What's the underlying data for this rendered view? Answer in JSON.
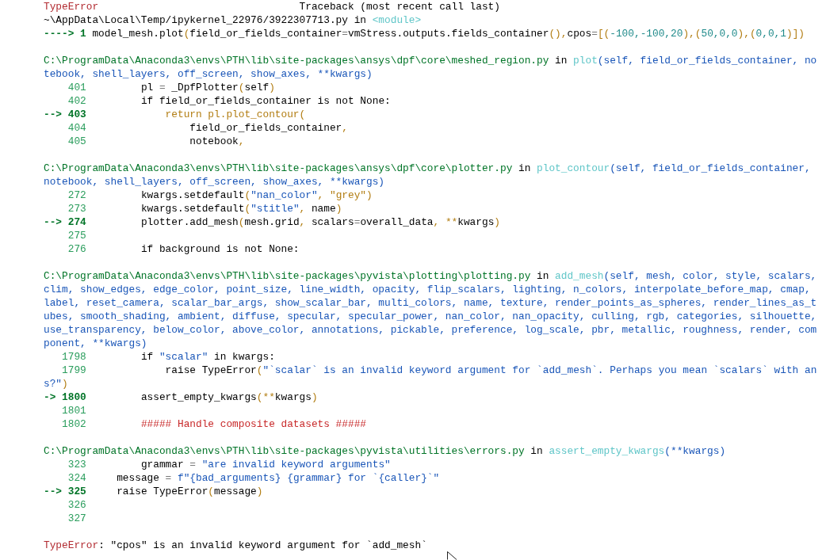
{
  "blocks": [
    {
      "lines": [
        {
          "parts": [
            {
              "kind": "ename",
              "text": "TypeError"
            },
            {
              "kind": "plain",
              "text": "                                 Traceback (most recent call last)"
            }
          ]
        },
        {
          "parts": [
            {
              "kind": "plain",
              "text": "~\\AppData\\Local\\Temp/ipykernel_22976/3922307713.py in "
            },
            {
              "kind": "fn",
              "text": "<module>"
            }
          ]
        },
        {
          "parts": [
            {
              "kind": "cur",
              "text": "----> 1 "
            },
            {
              "kind": "plain",
              "text": "model_mesh.plot"
            },
            {
              "kind": "punct",
              "text": "("
            },
            {
              "kind": "plain",
              "text": "field_or_fields_container"
            },
            {
              "kind": "op",
              "text": "="
            },
            {
              "kind": "plain",
              "text": "vmStress.outputs.fields_container"
            },
            {
              "kind": "punct",
              "text": "(),"
            },
            {
              "kind": "plain",
              "text": "cpos"
            },
            {
              "kind": "op",
              "text": "="
            },
            {
              "kind": "punct",
              "text": "[("
            },
            {
              "kind": "lit",
              "text": "-100,-100,20"
            },
            {
              "kind": "punct",
              "text": "),("
            },
            {
              "kind": "lit",
              "text": "50,0,0"
            },
            {
              "kind": "punct",
              "text": "),("
            },
            {
              "kind": "lit",
              "text": "0,0,1"
            },
            {
              "kind": "punct",
              "text": ")])"
            }
          ]
        }
      ]
    },
    {
      "lines": [
        {
          "parts": [
            {
              "kind": "path",
              "text": "C:\\ProgramData\\Anaconda3\\envs\\PTH\\lib\\site-packages\\ansys\\dpf\\core\\meshed_region.py"
            },
            {
              "kind": "plain",
              "text": " in "
            },
            {
              "kind": "fn",
              "text": "plot"
            },
            {
              "kind": "arg",
              "text": "(self, field_or_fields_container, no"
            }
          ]
        },
        {
          "parts": [
            {
              "kind": "arg",
              "text": "tebook, shell_layers, off_screen, show_axes, **kwargs)"
            }
          ]
        },
        {
          "parts": [
            {
              "kind": "num",
              "text": "    401"
            },
            {
              "kind": "plain",
              "text": "         pl "
            },
            {
              "kind": "op",
              "text": "="
            },
            {
              "kind": "plain",
              "text": " _DpfPlotter"
            },
            {
              "kind": "punct",
              "text": "("
            },
            {
              "kind": "plain",
              "text": "self"
            },
            {
              "kind": "punct",
              "text": ")"
            }
          ]
        },
        {
          "parts": [
            {
              "kind": "num",
              "text": "    402"
            },
            {
              "kind": "plain",
              "text": "         if field_or_fields_container is not None:"
            }
          ]
        },
        {
          "parts": [
            {
              "kind": "cur",
              "text": "--> 403"
            },
            {
              "kind": "punct",
              "text": "             return pl.plot_contour("
            }
          ]
        },
        {
          "parts": [
            {
              "kind": "num",
              "text": "    404"
            },
            {
              "kind": "plain",
              "text": "                 field_or_fields_container"
            },
            {
              "kind": "punct",
              "text": ","
            }
          ]
        },
        {
          "parts": [
            {
              "kind": "num",
              "text": "    405"
            },
            {
              "kind": "plain",
              "text": "                 notebook"
            },
            {
              "kind": "punct",
              "text": ","
            }
          ]
        }
      ]
    },
    {
      "lines": [
        {
          "parts": [
            {
              "kind": "path",
              "text": "C:\\ProgramData\\Anaconda3\\envs\\PTH\\lib\\site-packages\\ansys\\dpf\\core\\plotter.py"
            },
            {
              "kind": "plain",
              "text": " in "
            },
            {
              "kind": "fn",
              "text": "plot_contour"
            },
            {
              "kind": "arg",
              "text": "(self, field_or_fields_container,"
            }
          ]
        },
        {
          "parts": [
            {
              "kind": "arg",
              "text": "notebook, shell_layers, off_screen, show_axes, **kwargs)"
            }
          ]
        },
        {
          "parts": [
            {
              "kind": "num",
              "text": "    272"
            },
            {
              "kind": "plain",
              "text": "         kwargs.setdefault"
            },
            {
              "kind": "punct",
              "text": "("
            },
            {
              "kind": "str",
              "text": "\"nan_color\""
            },
            {
              "kind": "punct",
              "text": ", "
            },
            {
              "kind": "punct",
              "text": "\"grey\")"
            }
          ]
        },
        {
          "parts": [
            {
              "kind": "num",
              "text": "    273"
            },
            {
              "kind": "plain",
              "text": "         kwargs.setdefault"
            },
            {
              "kind": "punct",
              "text": "("
            },
            {
              "kind": "str",
              "text": "\"stitle\""
            },
            {
              "kind": "punct",
              "text": ", "
            },
            {
              "kind": "plain",
              "text": "name"
            },
            {
              "kind": "punct",
              "text": ")"
            }
          ]
        },
        {
          "parts": [
            {
              "kind": "cur",
              "text": "--> 274"
            },
            {
              "kind": "plain",
              "text": "         plotter.add_mesh"
            },
            {
              "kind": "punct",
              "text": "("
            },
            {
              "kind": "plain",
              "text": "mesh.grid"
            },
            {
              "kind": "punct",
              "text": ", "
            },
            {
              "kind": "plain",
              "text": "scalars"
            },
            {
              "kind": "op",
              "text": "="
            },
            {
              "kind": "plain",
              "text": "overall_data"
            },
            {
              "kind": "punct",
              "text": ", **"
            },
            {
              "kind": "plain",
              "text": "kwargs"
            },
            {
              "kind": "punct",
              "text": ")"
            }
          ]
        },
        {
          "parts": [
            {
              "kind": "num",
              "text": "    275"
            }
          ]
        },
        {
          "parts": [
            {
              "kind": "num",
              "text": "    276"
            },
            {
              "kind": "plain",
              "text": "         if background is not None:"
            }
          ]
        }
      ]
    },
    {
      "lines": [
        {
          "parts": [
            {
              "kind": "path",
              "text": "C:\\ProgramData\\Anaconda3\\envs\\PTH\\lib\\site-packages\\pyvista\\plotting\\plotting.py"
            },
            {
              "kind": "plain",
              "text": " in "
            },
            {
              "kind": "fn",
              "text": "add_mesh"
            },
            {
              "kind": "arg",
              "text": "(self, mesh, color, style, scalars,"
            }
          ]
        },
        {
          "parts": [
            {
              "kind": "arg",
              "text": "clim, show_edges, edge_color, point_size, line_width, opacity, flip_scalars, lighting, n_colors, interpolate_before_map, cmap,"
            }
          ]
        },
        {
          "parts": [
            {
              "kind": "arg",
              "text": "label, reset_camera, scalar_bar_args, show_scalar_bar, multi_colors, name, texture, render_points_as_spheres, render_lines_as_t"
            }
          ]
        },
        {
          "parts": [
            {
              "kind": "arg",
              "text": "ubes, smooth_shading, ambient, diffuse, specular, specular_power, nan_color, nan_opacity, culling, rgb, categories, silhouette,"
            }
          ]
        },
        {
          "parts": [
            {
              "kind": "arg",
              "text": "use_transparency, below_color, above_color, annotations, pickable, preference, log_scale, pbr, metallic, roughness, render, com"
            }
          ]
        },
        {
          "parts": [
            {
              "kind": "arg",
              "text": "ponent, **kwargs)"
            }
          ]
        },
        {
          "parts": [
            {
              "kind": "num",
              "text": "   1798"
            },
            {
              "kind": "plain",
              "text": "         if "
            },
            {
              "kind": "str",
              "text": "\"scalar\""
            },
            {
              "kind": "plain",
              "text": " in kwargs:"
            }
          ]
        },
        {
          "parts": [
            {
              "kind": "num",
              "text": "   1799"
            },
            {
              "kind": "plain",
              "text": "             raise TypeError"
            },
            {
              "kind": "punct",
              "text": "("
            },
            {
              "kind": "str",
              "text": "\"`scalar` is an invalid keyword argument for `add_mesh`. Perhaps you mean `scalars` with an"
            }
          ]
        },
        {
          "parts": [
            {
              "kind": "str",
              "text": "s?\""
            },
            {
              "kind": "punct",
              "text": ")"
            }
          ]
        },
        {
          "parts": [
            {
              "kind": "cur",
              "text": "-> 1800"
            },
            {
              "kind": "plain",
              "text": "         assert_empty_kwargs"
            },
            {
              "kind": "punct",
              "text": "(**"
            },
            {
              "kind": "plain",
              "text": "kwargs"
            },
            {
              "kind": "punct",
              "text": ")"
            }
          ]
        },
        {
          "parts": [
            {
              "kind": "num",
              "text": "   1801"
            }
          ]
        },
        {
          "parts": [
            {
              "kind": "num",
              "text": "   1802"
            },
            {
              "kind": "cmt",
              "text": "         ##### Handle composite datasets #####"
            }
          ]
        }
      ]
    },
    {
      "lines": [
        {
          "parts": [
            {
              "kind": "path",
              "text": "C:\\ProgramData\\Anaconda3\\envs\\PTH\\lib\\site-packages\\pyvista\\utilities\\errors.py"
            },
            {
              "kind": "plain",
              "text": " in "
            },
            {
              "kind": "fn",
              "text": "assert_empty_kwargs"
            },
            {
              "kind": "arg",
              "text": "(**kwargs)"
            }
          ]
        },
        {
          "parts": [
            {
              "kind": "num",
              "text": "    323"
            },
            {
              "kind": "plain",
              "text": "         grammar "
            },
            {
              "kind": "op",
              "text": "="
            },
            {
              "kind": "str",
              "text": " \"are invalid keyword arguments\""
            }
          ]
        },
        {
          "parts": [
            {
              "kind": "num",
              "text": "    324"
            },
            {
              "kind": "plain",
              "text": "     message "
            },
            {
              "kind": "op",
              "text": "="
            },
            {
              "kind": "str",
              "text": " f\"{bad_arguments} {grammar} for `{caller}`\""
            }
          ]
        },
        {
          "parts": [
            {
              "kind": "cur",
              "text": "--> 325"
            },
            {
              "kind": "plain",
              "text": "     raise TypeError"
            },
            {
              "kind": "punct",
              "text": "("
            },
            {
              "kind": "plain",
              "text": "message"
            },
            {
              "kind": "punct",
              "text": ")"
            }
          ]
        },
        {
          "parts": [
            {
              "kind": "num",
              "text": "    326"
            }
          ]
        },
        {
          "parts": [
            {
              "kind": "num",
              "text": "    327"
            }
          ]
        }
      ]
    },
    {
      "lines": [
        {
          "parts": [
            {
              "kind": "ename",
              "text": "TypeError"
            },
            {
              "kind": "plain",
              "text": ": \"cpos\" is an invalid keyword argument for `add_mesh`"
            }
          ]
        }
      ]
    }
  ]
}
